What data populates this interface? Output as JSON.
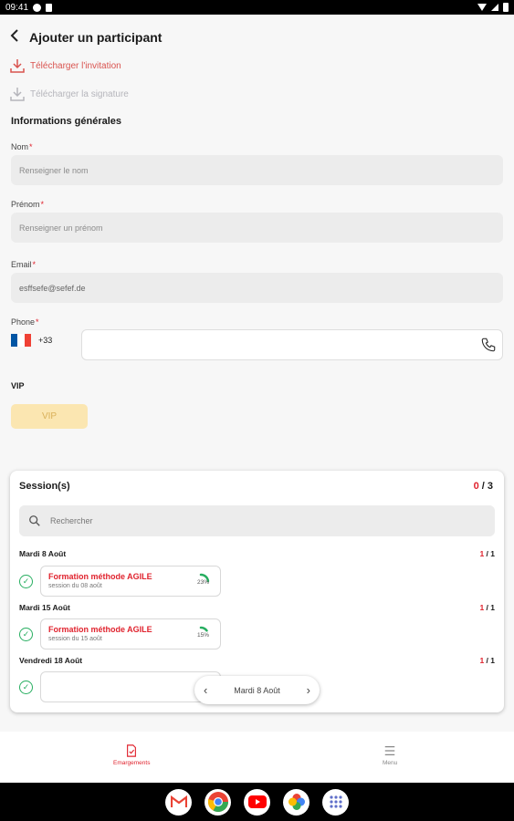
{
  "status_bar": {
    "time": "09:41"
  },
  "header": {
    "title": "Ajouter un participant"
  },
  "actions": {
    "download_invitation": "Télécharger l'invitation",
    "download_signature": "Télécharger la signature"
  },
  "section_title": "Informations générales",
  "fields": {
    "nom": {
      "label": "Nom",
      "required": "*",
      "placeholder": "Renseigner le nom"
    },
    "prenom": {
      "label": "Prénom",
      "required": "*",
      "placeholder": "Renseigner un prénom"
    },
    "email": {
      "label": "Email",
      "required": "*",
      "value": "esffsefe@sefef.de"
    },
    "phone": {
      "label": "Phone",
      "required": "*",
      "prefix": "+33",
      "value": ""
    }
  },
  "vip": {
    "label": "VIP",
    "toggle_text": "VIP"
  },
  "sessions": {
    "title": "Session(s)",
    "counter_selected": "0",
    "counter_total": " / 3",
    "search_placeholder": "Rechercher",
    "days": [
      {
        "label": "Mardi 8 Août",
        "count_done": "1",
        "count_total": " / 1",
        "session": {
          "name": "Formation méthode AGILE",
          "sub": "session du 08 août",
          "progress_text": "23%",
          "progress": 0.23
        }
      },
      {
        "label": "Mardi 15 Août",
        "count_done": "1",
        "count_total": " / 1",
        "session": {
          "name": "Formation méthode AGILE",
          "sub": "session du 15 août",
          "progress_text": "15%",
          "progress": 0.15
        }
      },
      {
        "label": "Vendredi 18 Août",
        "count_done": "1",
        "count_total": " / 1"
      }
    ],
    "date_nav": {
      "label": "Mardi 8 Août"
    }
  },
  "bottom_nav": {
    "emargements": "Emargements",
    "menu": "Menu"
  },
  "colors": {
    "accent": "#e0232e",
    "success": "#27ae60",
    "vip": "#fbe6b1"
  },
  "android_apps": [
    "gmail-icon",
    "chrome-icon",
    "youtube-icon",
    "photos-icon",
    "apps-icon"
  ]
}
